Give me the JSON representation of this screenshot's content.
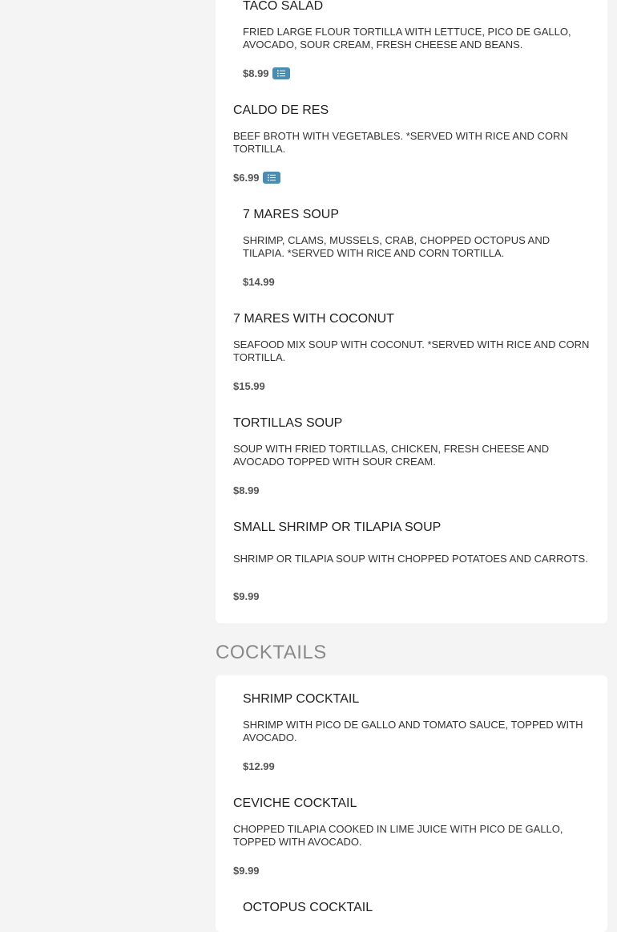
{
  "sections": {
    "soups": {
      "items": [
        {
          "name": "TACO SALAD",
          "description": "FRIED LARGE FLOUR TORTILLA WITH LETTUCE, PICO DE GALLO, AVOCADO, SOUR CREAM, FRESH CHEESE AND BEANS.",
          "price": "$8.99",
          "has_options": true
        },
        {
          "name": "CALDO DE RES",
          "description": "BEEF BROTH WITH VEGETABLES. *SERVED WITH RICE AND CORN TORTILLA.",
          "price": "$6.99",
          "has_options": true
        },
        {
          "name": "7 MARES SOUP",
          "description": "SHRIMP, CLAMS, MUSSELS, CRAB, CHOPPED OCTOPUS AND TILAPIA. *SERVED WITH RICE AND CORN TORTILLA.",
          "price": "$14.99",
          "has_options": false
        },
        {
          "name": "7 MARES WITH COCONUT",
          "description": "SEAFOOD MIX SOUP WITH COCONUT. *SERVED WITH RICE AND CORN TORTILLA.",
          "price": "$15.99",
          "has_options": false
        },
        {
          "name": "TORTILLAS SOUP",
          "description": "SOUP WITH FRIED TORTILLAS, CHICKEN, FRESH CHEESE AND AVOCADO TOPPED WITH SOUR CREAM.",
          "price": "$8.99",
          "has_options": false
        },
        {
          "name": "SMALL SHRIMP OR TILAPIA SOUP",
          "description": "SHRIMP OR TILAPIA SOUP WITH CHOPPED POTATOES AND CARROTS.",
          "price": "$9.99",
          "has_options": false
        }
      ]
    },
    "cocktails": {
      "title": "COCKTAILS",
      "items": [
        {
          "name": "SHRIMP COCKTAIL",
          "description": "SHRIMP WITH PICO DE GALLO AND TOMATO SAUCE, TOPPED WITH AVOCADO.",
          "price": "$12.99"
        },
        {
          "name": "CEVICHE COCKTAIL",
          "description": "CHOPPED TILAPIA COOKED IN LIME JUICE WITH PICO DE GALLO, TOPPED WITH AVOCADO.",
          "price": "$9.99"
        },
        {
          "name": "OCTOPUS COCKTAIL"
        }
      ]
    }
  },
  "colors": {
    "accent": "#4a8db3",
    "background": "#f4f4f4",
    "card": "#ffffff"
  },
  "icons": {
    "options": "list-icon"
  }
}
